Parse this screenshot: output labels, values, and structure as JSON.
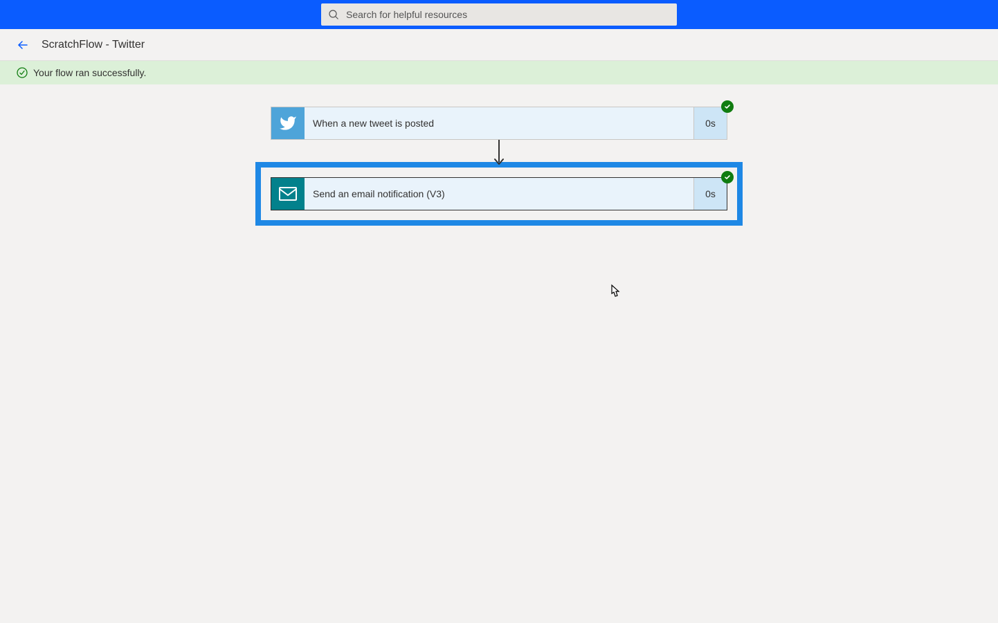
{
  "search": {
    "placeholder": "Search for helpful resources"
  },
  "header": {
    "title": "ScratchFlow - Twitter"
  },
  "status": {
    "message": "Your flow ran successfully."
  },
  "flow": {
    "steps": [
      {
        "label": "When a new tweet is posted",
        "duration": "0s",
        "icon": "twitter"
      },
      {
        "label": "Send an email notification (V3)",
        "duration": "0s",
        "icon": "email"
      }
    ]
  }
}
